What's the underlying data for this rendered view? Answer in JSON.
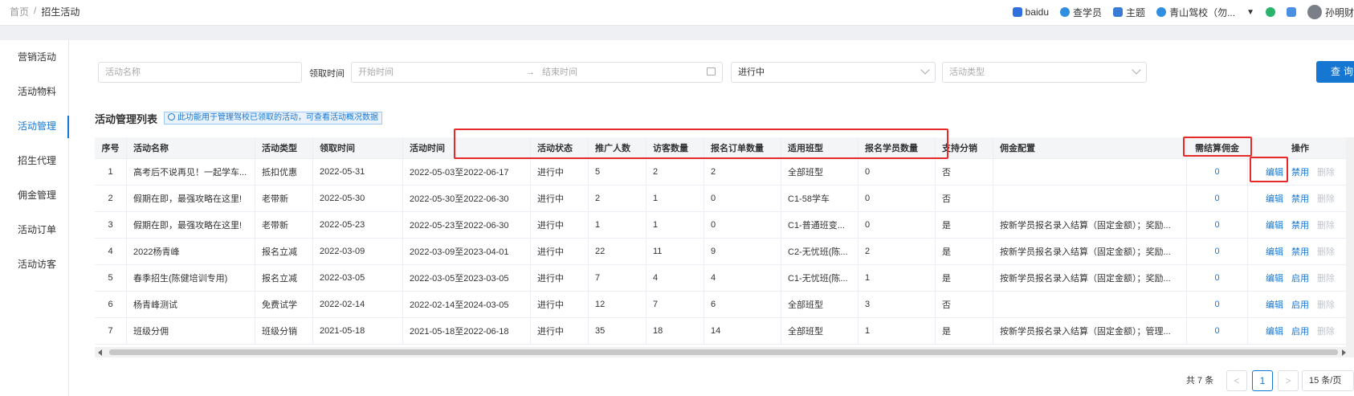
{
  "breadcrumb": {
    "home": "首页",
    "sep": "/",
    "current": "招生活动"
  },
  "topbar": {
    "baidu": "baidu",
    "learner": "查学员",
    "theme": "主题",
    "school": "青山驾校（勿...",
    "user": "孙明财",
    "colors": {
      "baidu": "#2f6fde",
      "learner": "#2f8ee0",
      "theme": "#3a7bd5",
      "school": "#2f8ee0",
      "green": "#29b36b",
      "monitor": "#4a90e2"
    }
  },
  "sidebar": {
    "items": [
      {
        "label": "营销活动",
        "active": false
      },
      {
        "label": "活动物料",
        "active": false
      },
      {
        "label": "活动管理",
        "active": true
      },
      {
        "label": "招生代理",
        "active": false
      },
      {
        "label": "佣金管理",
        "active": false
      },
      {
        "label": "活动订单",
        "active": false
      },
      {
        "label": "活动访客",
        "active": false
      }
    ]
  },
  "filters": {
    "name_placeholder": "活动名称",
    "receive_label": "领取时间",
    "start_placeholder": "开始时间",
    "arrow": "→",
    "end_placeholder": "结束时间",
    "status_value": "进行中",
    "type_placeholder": "活动类型",
    "query_label": "查询"
  },
  "list": {
    "title": "活动管理列表",
    "hint": "此功能用于管理驾校已领取的活动，可查看活动概况数据"
  },
  "table": {
    "columns": [
      "序号",
      "活动名称",
      "活动类型",
      "领取时间",
      "活动时间",
      "活动状态",
      "推广人数",
      "访客数量",
      "报名订单数量",
      "适用班型",
      "报名学员数量",
      "支持分销",
      "佣金配置",
      "需结算佣金",
      "操作"
    ],
    "rows": [
      {
        "no": "1",
        "name": "高考后不说再见！一起学车...",
        "type": "抵扣优惠",
        "receive": "2022-05-31",
        "period": "2022-05-03至2022-06-17",
        "status": "进行中",
        "promoters": "5",
        "visitors": "2",
        "orders": "2",
        "class": "全部班型",
        "students": "0",
        "dist": "否",
        "commission": "",
        "settle": "0",
        "op1": "编辑",
        "op2": "禁用",
        "op3": "删除"
      },
      {
        "no": "2",
        "name": "假期在即，最强攻略在这里!",
        "type": "老带新",
        "receive": "2022-05-30",
        "period": "2022-05-30至2022-06-30",
        "status": "进行中",
        "promoters": "2",
        "visitors": "1",
        "orders": "0",
        "class": "C1-58学车",
        "students": "0",
        "dist": "否",
        "commission": "",
        "settle": "0",
        "op1": "编辑",
        "op2": "禁用",
        "op3": "删除"
      },
      {
        "no": "3",
        "name": "假期在即，最强攻略在这里!",
        "type": "老带新",
        "receive": "2022-05-23",
        "period": "2022-05-23至2022-06-30",
        "status": "进行中",
        "promoters": "1",
        "visitors": "1",
        "orders": "0",
        "class": "C1-普通班变...",
        "students": "0",
        "dist": "是",
        "commission": "按新学员报名录入结算（固定金额）；奖励...",
        "settle": "0",
        "op1": "编辑",
        "op2": "禁用",
        "op3": "删除"
      },
      {
        "no": "4",
        "name": "2022杨青峰",
        "type": "报名立减",
        "receive": "2022-03-09",
        "period": "2022-03-09至2023-04-01",
        "status": "进行中",
        "promoters": "22",
        "visitors": "11",
        "orders": "9",
        "class": "C2-无忧班(陈...",
        "students": "2",
        "dist": "是",
        "commission": "按新学员报名录入结算（固定金额）；奖励...",
        "settle": "0",
        "op1": "编辑",
        "op2": "禁用",
        "op3": "删除"
      },
      {
        "no": "5",
        "name": "春季招生(陈健培训专用)",
        "type": "报名立减",
        "receive": "2022-03-05",
        "period": "2022-03-05至2023-03-05",
        "status": "进行中",
        "promoters": "7",
        "visitors": "4",
        "orders": "4",
        "class": "C1-无忧班(陈...",
        "students": "1",
        "dist": "是",
        "commission": "按新学员报名录入结算（固定金额）；奖励...",
        "settle": "0",
        "op1": "编辑",
        "op2": "启用",
        "op3": "删除"
      },
      {
        "no": "6",
        "name": "杨青峰测试",
        "type": "免费试学",
        "receive": "2022-02-14",
        "period": "2022-02-14至2024-03-05",
        "status": "进行中",
        "promoters": "12",
        "visitors": "7",
        "orders": "6",
        "class": "全部班型",
        "students": "3",
        "dist": "否",
        "commission": "",
        "settle": "0",
        "op1": "编辑",
        "op2": "启用",
        "op3": "删除"
      },
      {
        "no": "7",
        "name": "班级分佣",
        "type": "班级分销",
        "receive": "2021-05-18",
        "period": "2021-05-18至2022-06-18",
        "status": "进行中",
        "promoters": "35",
        "visitors": "18",
        "orders": "14",
        "class": "全部班型",
        "students": "1",
        "dist": "是",
        "commission": "按新学员报名录入结算（固定金额）；管理...",
        "settle": "0",
        "op1": "编辑",
        "op2": "启用",
        "op3": "删除"
      }
    ]
  },
  "pagination": {
    "total": "共 7 条",
    "prev": "<",
    "page": "1",
    "next": ">",
    "size": "15 条/页"
  },
  "colors": {
    "accent": "#1677d2",
    "highlight": "#e52a2a"
  }
}
